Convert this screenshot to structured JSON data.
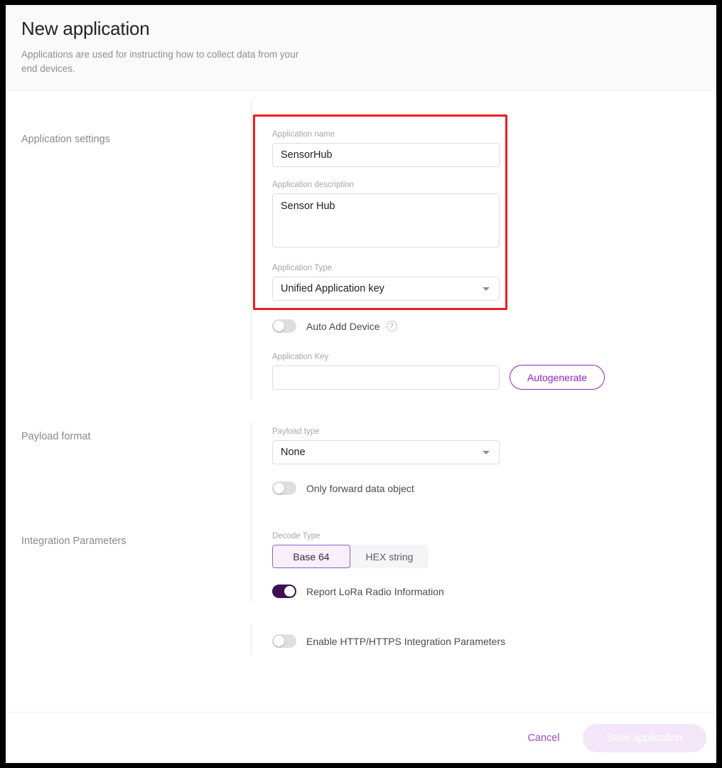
{
  "header": {
    "title": "New application",
    "subtitle": "Applications are used for instructing how to collect data from your end devices."
  },
  "sections": {
    "application_settings": {
      "label": "Application settings",
      "name_field": {
        "label": "Application name",
        "value": "SensorHub",
        "placeholder": ""
      },
      "description_field": {
        "label": "Application description",
        "value": "Sensor Hub",
        "placeholder": ""
      },
      "type_field": {
        "label": "Application Type",
        "value": "Unified Application key",
        "caret": "chevron-down-icon"
      },
      "auto_add_device": {
        "label": "Auto Add Device",
        "state": "off",
        "help": "?"
      },
      "application_key": {
        "label": "Application Key",
        "value": "",
        "placeholder": ""
      },
      "autogenerate_button": "Autogenerate"
    },
    "payload_format": {
      "label": "Payload format",
      "payload_type": {
        "label": "Payload type",
        "value": "None",
        "caret": "chevron-down-icon"
      },
      "only_forward": {
        "label": "Only forward data object",
        "state": "off"
      }
    },
    "integration_parameters": {
      "label": "Integration Parameters",
      "decode_type": {
        "label": "Decode Type",
        "options": [
          "Base 64",
          "HEX string"
        ],
        "selected": "Base 64"
      },
      "report_lora": {
        "label": "Report LoRa Radio Information",
        "state": "on"
      },
      "enable_http": {
        "label": "Enable HTTP/HTTPS Integration Parameters",
        "state": "off"
      }
    }
  },
  "footer": {
    "cancel_label": "Cancel",
    "save_label": "Save application"
  },
  "colors": {
    "accent": "#8e24c8",
    "toggle_on": "#3d1152",
    "highlight": "#ee1c25",
    "header_bg": "#fafafa"
  }
}
